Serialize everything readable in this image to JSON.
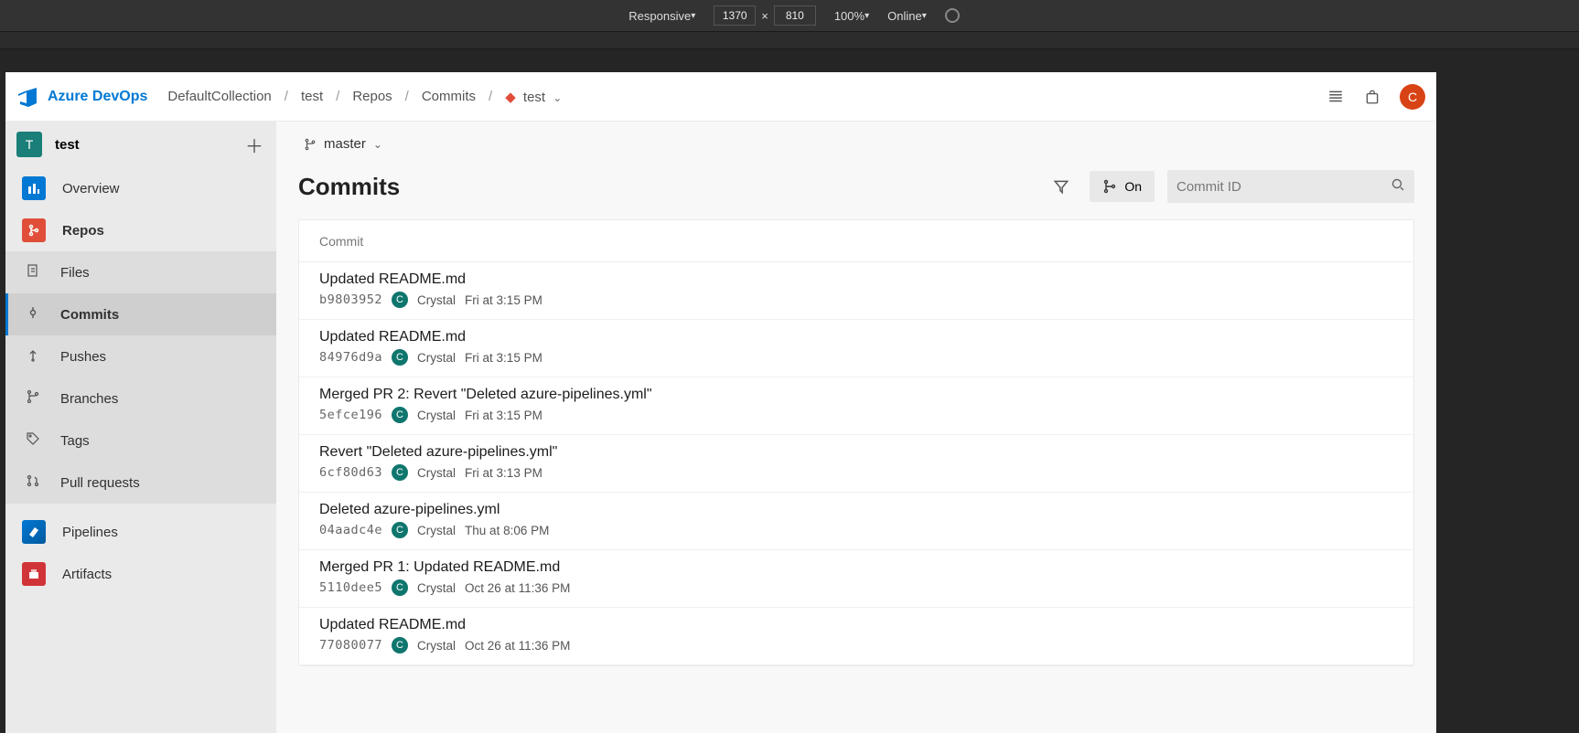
{
  "devtools": {
    "mode": "Responsive",
    "width": "1370",
    "height": "810",
    "zoom": "100%",
    "network": "Online"
  },
  "header": {
    "brand": "Azure DevOps",
    "crumbs": [
      "DefaultCollection",
      "test",
      "Repos",
      "Commits"
    ],
    "repo": "test",
    "avatar_initial": "C"
  },
  "project": {
    "initial": "T",
    "name": "test"
  },
  "sidebar": {
    "top": [
      {
        "label": "Overview",
        "tile": "blue"
      },
      {
        "label": "Repos",
        "tile": "orange",
        "active": true
      }
    ],
    "repos_sub": [
      {
        "label": "Files"
      },
      {
        "label": "Commits",
        "selected": true
      },
      {
        "label": "Pushes"
      },
      {
        "label": "Branches"
      },
      {
        "label": "Tags"
      },
      {
        "label": "Pull requests"
      }
    ],
    "bottom": [
      {
        "label": "Pipelines",
        "tile": "teal"
      },
      {
        "label": "Artifacts",
        "tile": "red"
      }
    ]
  },
  "main": {
    "branch": "master",
    "title": "Commits",
    "graph_toggle": "On",
    "search_placeholder": "Commit ID",
    "table_header": "Commit"
  },
  "commits": [
    {
      "msg": "Updated README.md",
      "hash": "b9803952",
      "author": "Crystal",
      "date": "Fri at 3:15 PM",
      "initial": "C"
    },
    {
      "msg": "Updated README.md",
      "hash": "84976d9a",
      "author": "Crystal",
      "date": "Fri at 3:15 PM",
      "initial": "C"
    },
    {
      "msg": "Merged PR 2: Revert \"Deleted azure-pipelines.yml\"",
      "hash": "5efce196",
      "author": "Crystal",
      "date": "Fri at 3:15 PM",
      "initial": "C"
    },
    {
      "msg": "Revert \"Deleted azure-pipelines.yml\"",
      "hash": "6cf80d63",
      "author": "Crystal",
      "date": "Fri at 3:13 PM",
      "initial": "C"
    },
    {
      "msg": "Deleted azure-pipelines.yml",
      "hash": "04aadc4e",
      "author": "Crystal",
      "date": "Thu at 8:06 PM",
      "initial": "C"
    },
    {
      "msg": "Merged PR 1: Updated README.md",
      "hash": "5110dee5",
      "author": "Crystal",
      "date": "Oct 26 at 11:36 PM",
      "initial": "C"
    },
    {
      "msg": "Updated README.md",
      "hash": "77080077",
      "author": "Crystal",
      "date": "Oct 26 at 11:36 PM",
      "initial": "C"
    }
  ]
}
